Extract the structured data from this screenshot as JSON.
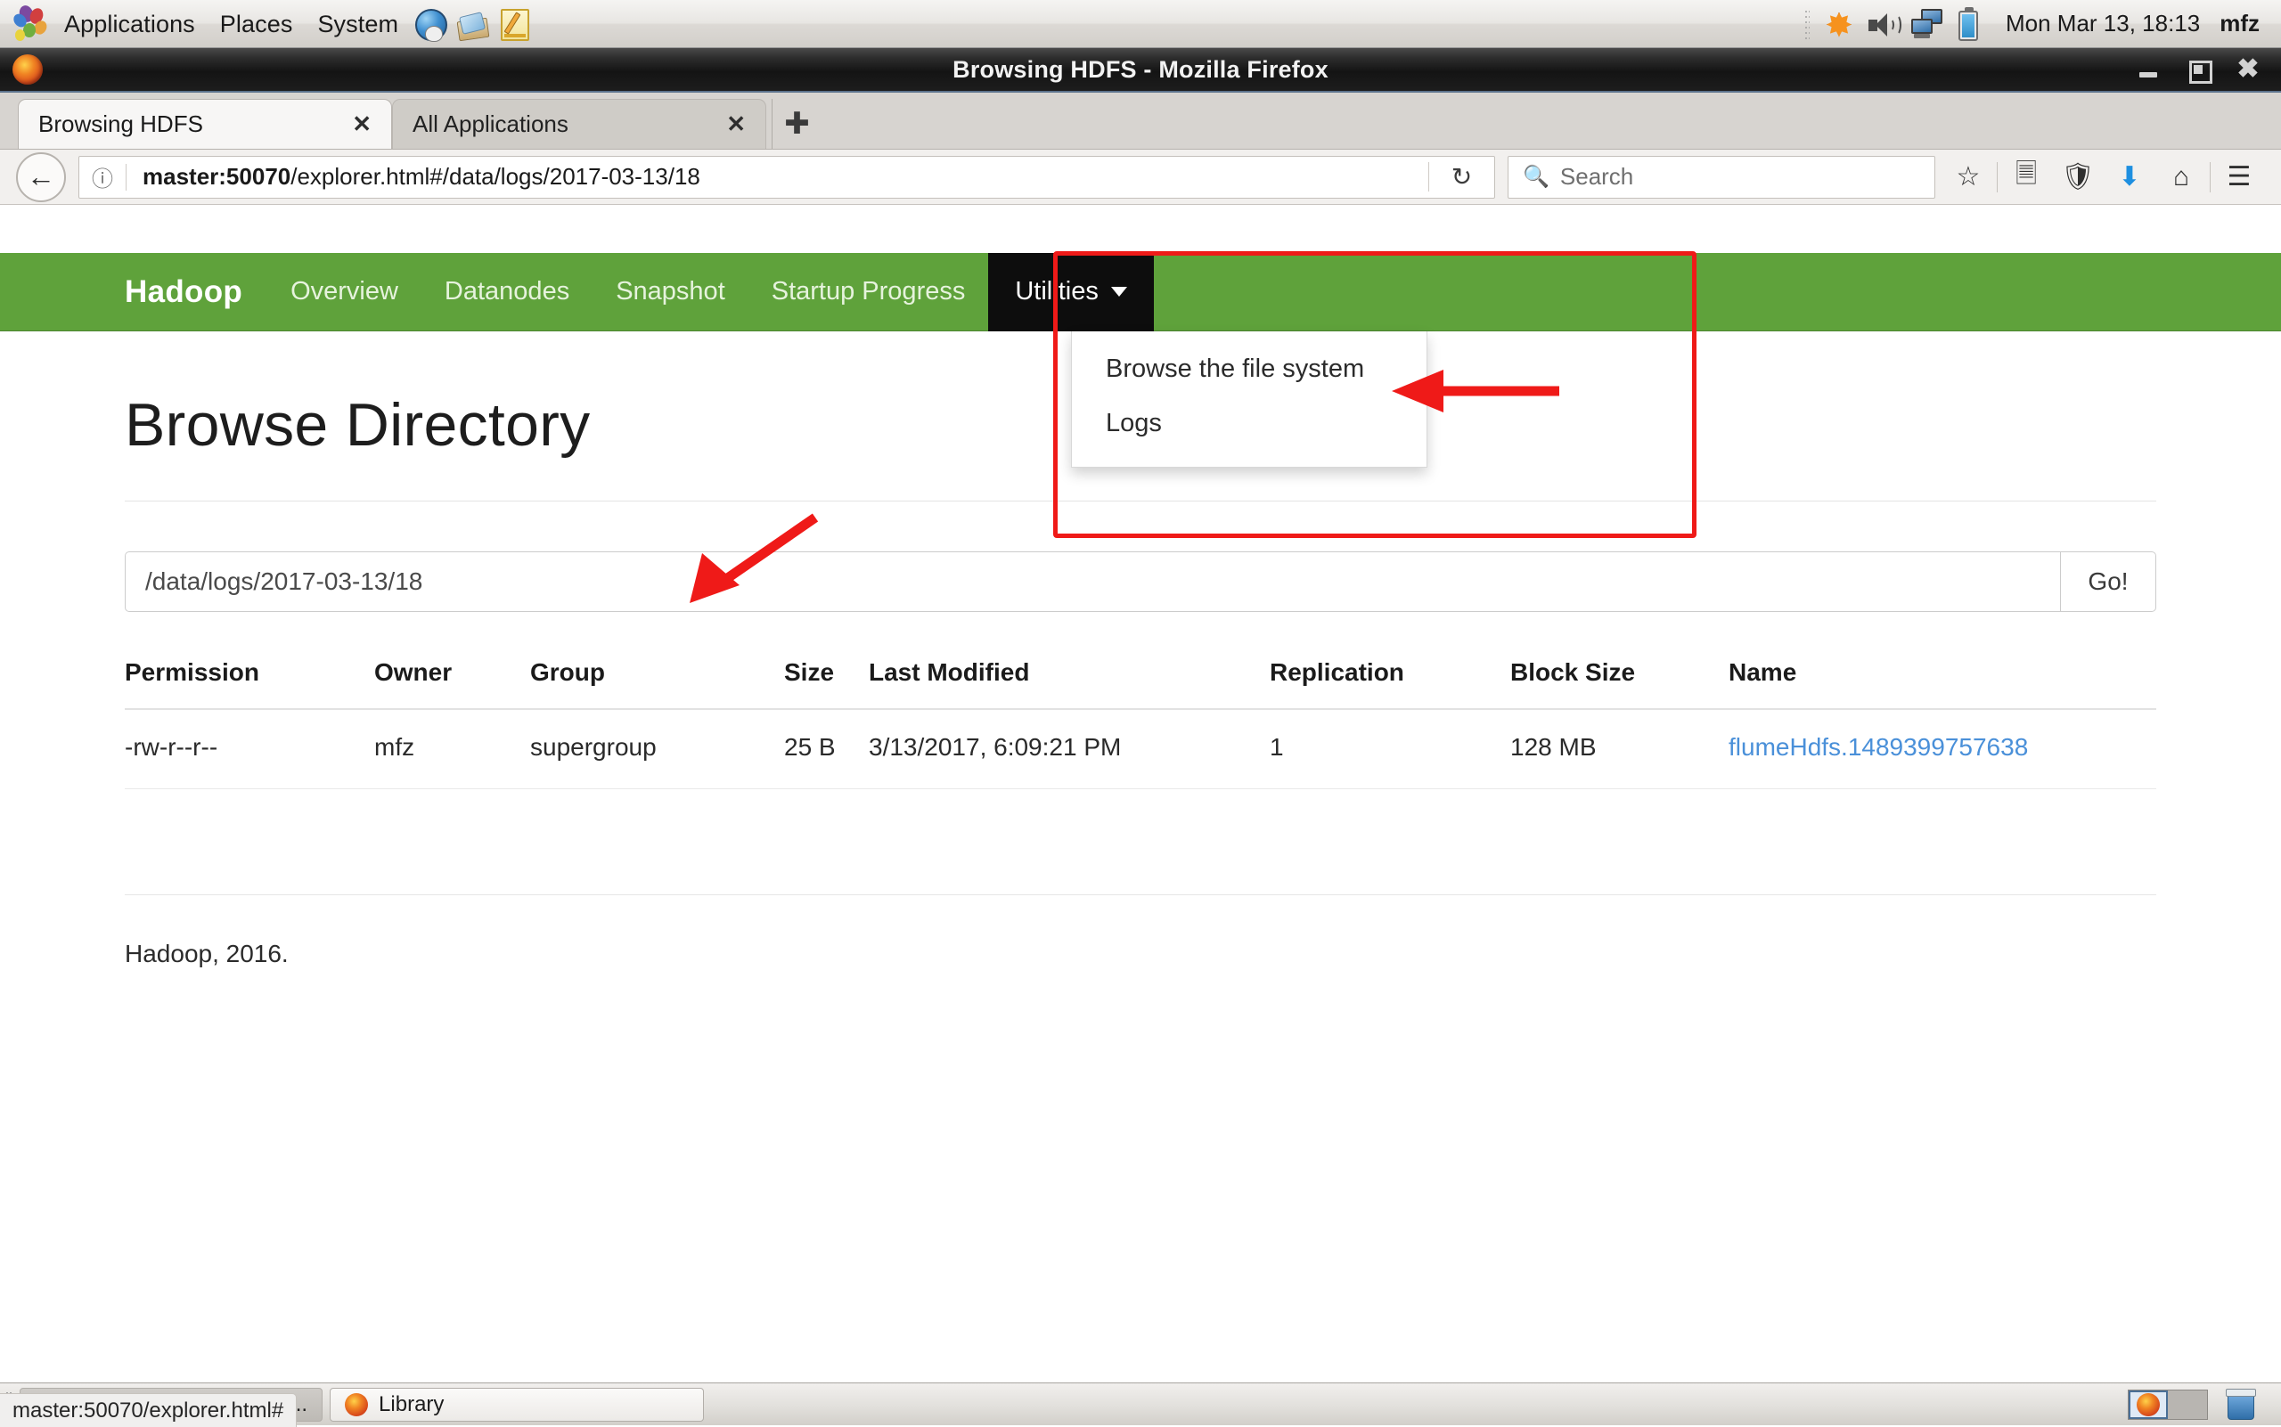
{
  "desktop": {
    "menus": [
      "Applications",
      "Places",
      "System"
    ],
    "launchers": [
      "globe-icon",
      "mail-icon",
      "notepad-icon"
    ],
    "tray": [
      "sun-icon",
      "speaker-icon",
      "network-icon",
      "battery-icon"
    ],
    "clock": "Mon Mar 13, 18:13",
    "user": "mfz"
  },
  "browser": {
    "window_title": "Browsing HDFS - Mozilla Firefox",
    "window_buttons": {
      "minimize": "minimize-icon",
      "maximize": "maximize-icon",
      "close": "close-icon"
    },
    "tabs": [
      {
        "label": "Browsing HDFS",
        "active": true,
        "close": "✕"
      },
      {
        "label": "All Applications",
        "active": false,
        "close": "✕"
      }
    ],
    "new_tab_label": "✚",
    "back_label": "←",
    "url": {
      "host": "master:50070",
      "path": "/explorer.html#/data/logs/2017-03-13/18"
    },
    "url_info_icon": "ⓘ",
    "reload_label": "↻",
    "search": {
      "placeholder": "Search",
      "icon": "search-icon"
    },
    "toolbar_icons": [
      "bookmark-star-icon",
      "reader-list-icon",
      "shield-icon",
      "downloads-icon",
      "home-icon",
      "hamburger-menu-icon"
    ],
    "status_tip": "master:50070/explorer.html#"
  },
  "hadoop": {
    "brand": "Hadoop",
    "nav_links": [
      "Overview",
      "Datanodes",
      "Snapshot",
      "Startup Progress"
    ],
    "utilities_label": "Utilities",
    "dropdown_items": [
      "Browse the file system",
      "Logs"
    ],
    "page_title": "Browse Directory",
    "path_value": "/data/logs/2017-03-13/18",
    "go_label": "Go!",
    "table": {
      "headers": [
        "Permission",
        "Owner",
        "Group",
        "Size",
        "Last Modified",
        "Replication",
        "Block Size",
        "Name"
      ],
      "rows": [
        {
          "permission": "-rw-r--r--",
          "owner": "mfz",
          "group": "supergroup",
          "size": "25 B",
          "last_modified": "3/13/2017, 6:09:21 PM",
          "replication": "1",
          "block_size": "128 MB",
          "name": "flumeHdfs.1489399757638"
        }
      ]
    },
    "footer": "Hadoop, 2016."
  },
  "taskbar": {
    "windows": [
      {
        "label": "Browsing HDFS - Mozil...",
        "active": true
      },
      {
        "label": "Library",
        "active": false
      }
    ],
    "workspaces": 2,
    "trash": "trash-icon"
  },
  "annotations": {
    "highlight_box_color": "#ef1a18",
    "arrow_to_menu_item": "Browse the file system",
    "arrow_to_title_rule": "Browse Directory"
  }
}
